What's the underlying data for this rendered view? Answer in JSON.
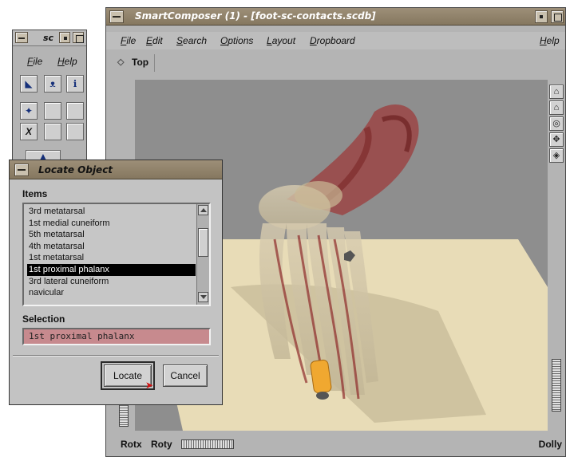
{
  "main": {
    "title": "SmartComposer (1) - [foot-sc-contacts.scdb]",
    "menus": [
      "File",
      "Edit",
      "Search",
      "Options",
      "Layout",
      "Dropboard"
    ],
    "help_menu": "Help",
    "breadcrumb": "Top",
    "bottom_labels": {
      "rotx": "Rotx",
      "roty": "Roty",
      "dolly": "Dolly"
    },
    "right_toolbar_icons": [
      "home-icon",
      "set-home-icon",
      "view-all-icon",
      "seek-icon",
      "perspective-icon"
    ]
  },
  "palette": {
    "title": "sc",
    "menus": [
      "File",
      "Help"
    ],
    "tools": [
      "select-arrow-icon",
      "pick-icon",
      "info-icon",
      "scene-icon",
      "x-icon"
    ]
  },
  "locate_dialog": {
    "title": "Locate Object",
    "items_label": "Items",
    "items": [
      "3rd metatarsal",
      "1st medial cuneiform",
      "5th metatarsal",
      "4th metatarsal",
      "1st metatarsal",
      "1st proximal phalanx",
      "3rd lateral cuneiform",
      "navicular"
    ],
    "selected_index": 5,
    "selection_label": "Selection",
    "selection_value": "1st proximal phalanx",
    "locate_button": "Locate",
    "cancel_button": "Cancel"
  },
  "colors": {
    "selection_field": "#c78a8e",
    "highlight": "#f0a830",
    "title_bar": "#8f826b"
  }
}
